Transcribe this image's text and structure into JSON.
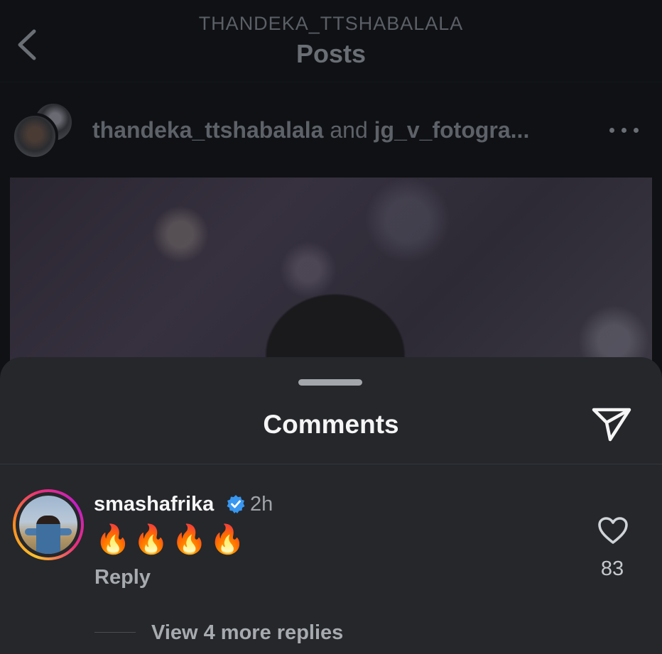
{
  "header": {
    "username": "THANDEKA_TTSHABALALA",
    "title": "Posts"
  },
  "post": {
    "owner": "thandeka_ttshabalala",
    "conjunction": "and",
    "collaborator": "jg_v_fotogra..."
  },
  "comments_sheet": {
    "title": "Comments"
  },
  "comment": {
    "username": "smashafrika",
    "time": "2h",
    "text": "🔥🔥🔥🔥",
    "reply_label": "Reply",
    "like_count": "83",
    "view_replies_label": "View 4 more replies"
  },
  "icons": {
    "back": "chevron-left-icon",
    "more": "more-horizontal-icon",
    "send": "paper-plane-icon",
    "verified": "verified-badge-icon",
    "like": "heart-outline-icon"
  },
  "colors": {
    "sheet_background": "#25272b",
    "verified_blue": "#3897f0",
    "story_ring_start": "#f9c12d",
    "story_ring_end": "#c21ec7"
  }
}
